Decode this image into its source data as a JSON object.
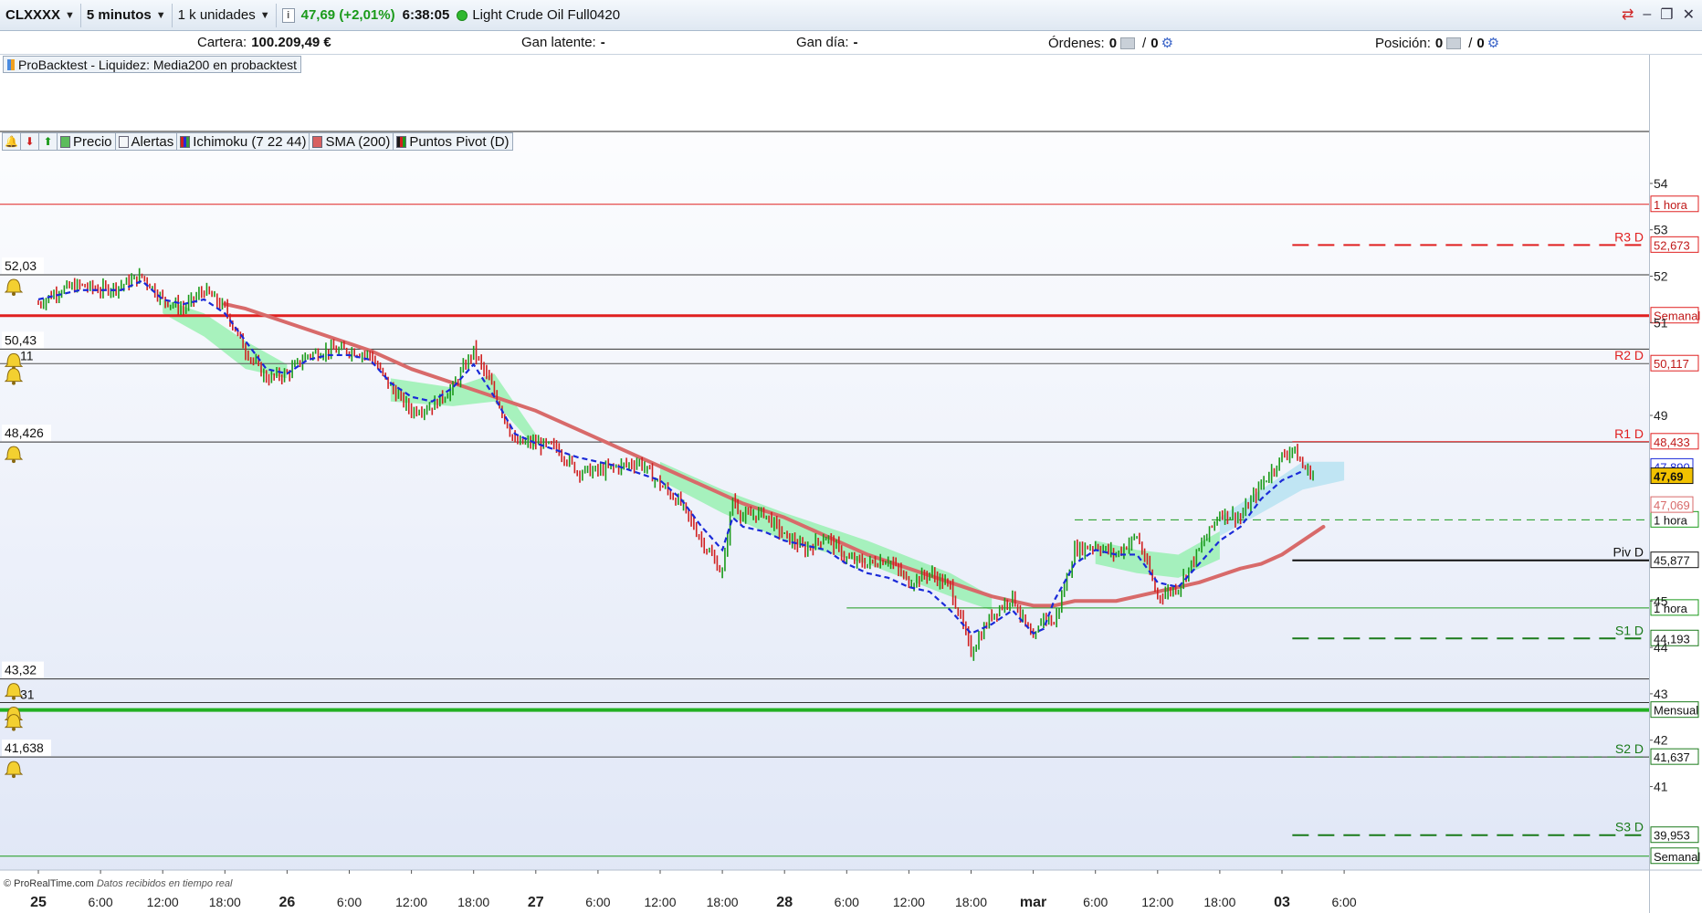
{
  "toolbar": {
    "symbol": "CLXXXX",
    "timeframe": "5 minutos",
    "units": "1 k unidades",
    "info_icon": "info-icon",
    "price": "47,69 (+2,01%)",
    "time": "6:38:05",
    "instrument": "Light Crude Oil Full0420"
  },
  "status": {
    "cartera_label": "Cartera:",
    "cartera_value": "100.209,49 €",
    "gan_latente_label": "Gan latente:",
    "gan_latente_value": "-",
    "gan_dia_label": "Gan día:",
    "gan_dia_value": "-",
    "ordenes_label": "Órdenes:",
    "ordenes_value": "0",
    "ordenes_value2": "0",
    "posicion_label": "Posición:",
    "posicion_value": "0",
    "posicion_value2": "0"
  },
  "probacktest_label": "ProBacktest - Liquidez: Media200 en probacktest",
  "indicators": [
    {
      "label": "Precio",
      "color": "#5cbc5c"
    },
    {
      "label": "Alertas",
      "color": "#f4f6f8"
    },
    {
      "label": "Ichimoku (7 22 44)",
      "color": "#5a3ad0"
    },
    {
      "label": "SMA (200)",
      "color": "#d86060"
    },
    {
      "label": "Puntos Pivot (D)",
      "color": "#1a7a1a"
    }
  ],
  "copyright": "© ProRealTime.com",
  "copyright_note": "Datos recibidos en tiempo real",
  "colors": {
    "sma": "#d86a6a",
    "ichimoku_kijun": "#1a2ad8",
    "cloud_green": "#8ef0a8",
    "cloud_blue": "#b0e0f0",
    "pivot_red": "#e02020",
    "pivot_green": "#1a7a1a",
    "price_tag": "#f2c200"
  },
  "chart_data": {
    "type": "line",
    "title": "",
    "ylim": [
      39.2,
      55.1
    ],
    "y_ticks": [
      41,
      42,
      43,
      44,
      45,
      49,
      51,
      52,
      53,
      54
    ],
    "x_ticks": [
      {
        "label": "25",
        "bold": true,
        "t": 0
      },
      {
        "label": "6:00",
        "t": 6
      },
      {
        "label": "12:00",
        "t": 12
      },
      {
        "label": "18:00",
        "t": 18
      },
      {
        "label": "26",
        "bold": true,
        "t": 24
      },
      {
        "label": "6:00",
        "t": 30
      },
      {
        "label": "12:00",
        "t": 36
      },
      {
        "label": "18:00",
        "t": 42
      },
      {
        "label": "27",
        "bold": true,
        "t": 48
      },
      {
        "label": "6:00",
        "t": 54
      },
      {
        "label": "12:00",
        "t": 60
      },
      {
        "label": "18:00",
        "t": 66
      },
      {
        "label": "28",
        "bold": true,
        "t": 72
      },
      {
        "label": "6:00",
        "t": 78
      },
      {
        "label": "12:00",
        "t": 84
      },
      {
        "label": "18:00",
        "t": 90
      },
      {
        "label": "mar",
        "bold": true,
        "t": 96
      },
      {
        "label": "6:00",
        "t": 102
      },
      {
        "label": "12:00",
        "t": 108
      },
      {
        "label": "18:00",
        "t": 114
      },
      {
        "label": "03",
        "bold": true,
        "t": 120
      },
      {
        "label": "6:00",
        "t": 126
      }
    ],
    "price_series": {
      "name": "Precio",
      "t": [
        0,
        2,
        4,
        6,
        8,
        10,
        12,
        14,
        16,
        18,
        20,
        22,
        24,
        26,
        28,
        30,
        32,
        34,
        36,
        38,
        40,
        42,
        44,
        46,
        48,
        50,
        52,
        54,
        56,
        58,
        60,
        62,
        64,
        66,
        67,
        68,
        70,
        72,
        74,
        76,
        78,
        80,
        82,
        84,
        86,
        88,
        90,
        92,
        94,
        96,
        97,
        98,
        100,
        102,
        104,
        106,
        108,
        110,
        112,
        114,
        116,
        118,
        120,
        121,
        122,
        123
      ],
      "y": [
        51.4,
        51.7,
        51.8,
        51.7,
        51.8,
        52.0,
        51.5,
        51.3,
        51.7,
        51.3,
        50.4,
        49.8,
        49.9,
        50.3,
        50.4,
        50.4,
        50.3,
        49.6,
        49.1,
        49.2,
        49.6,
        50.4,
        49.5,
        48.4,
        48.4,
        48.3,
        47.8,
        47.8,
        47.9,
        48.0,
        47.5,
        47.1,
        46.3,
        45.6,
        47.2,
        46.8,
        46.9,
        46.4,
        46.1,
        46.4,
        45.9,
        45.8,
        45.9,
        45.4,
        45.6,
        45.3,
        43.9,
        44.7,
        45.1,
        44.1,
        44.7,
        44.5,
        46.1,
        46.2,
        46.0,
        46.4,
        45.1,
        45.3,
        46.1,
        46.9,
        46.8,
        47.5,
        48.1,
        48.3,
        47.9,
        47.7
      ]
    },
    "kijun_series": {
      "name": "Ichimoku",
      "t": [
        0,
        4,
        8,
        10,
        12,
        14,
        16,
        18,
        20,
        22,
        24,
        26,
        28,
        30,
        32,
        34,
        36,
        38,
        40,
        42,
        44,
        46,
        48,
        52,
        56,
        60,
        62,
        64,
        66,
        67,
        68,
        70,
        72,
        74,
        76,
        78,
        80,
        82,
        84,
        86,
        88,
        90,
        92,
        94,
        96,
        97,
        98,
        100,
        102,
        104,
        106,
        108,
        110,
        112,
        114,
        116,
        118,
        120,
        122
      ],
      "y": [
        51.5,
        51.7,
        51.7,
        51.9,
        51.5,
        51.4,
        51.5,
        51.2,
        50.6,
        50.0,
        49.9,
        50.2,
        50.3,
        50.3,
        50.2,
        49.7,
        49.4,
        49.3,
        49.6,
        50.1,
        49.4,
        48.6,
        48.4,
        48.1,
        47.9,
        47.6,
        47.2,
        46.6,
        46.1,
        46.8,
        46.6,
        46.5,
        46.3,
        46.2,
        46.1,
        45.8,
        45.6,
        45.5,
        45.3,
        45.2,
        44.8,
        44.3,
        44.5,
        44.8,
        44.3,
        44.4,
        45.0,
        45.8,
        46.1,
        46.0,
        46.0,
        45.4,
        45.3,
        45.8,
        46.3,
        46.6,
        47.2,
        47.6,
        47.8
      ]
    },
    "sma_series": {
      "name": "SMA (200)",
      "t": [
        18,
        20,
        24,
        28,
        32,
        36,
        40,
        44,
        48,
        52,
        56,
        60,
        64,
        68,
        72,
        76,
        80,
        84,
        88,
        92,
        96,
        98,
        100,
        104,
        108,
        112,
        116,
        118,
        120,
        122,
        124
      ],
      "y": [
        51.4,
        51.3,
        51.0,
        50.7,
        50.4,
        50.0,
        49.7,
        49.4,
        49.1,
        48.7,
        48.3,
        47.9,
        47.5,
        47.1,
        46.8,
        46.4,
        46.0,
        45.7,
        45.4,
        45.1,
        44.9,
        44.9,
        45.0,
        45.0,
        45.2,
        45.4,
        45.7,
        45.8,
        46.0,
        46.3,
        46.6
      ]
    },
    "cloud_segments": [
      {
        "t": [
          12,
          16,
          20,
          24
        ],
        "top": [
          51.5,
          51.2,
          50.6,
          50.1
        ],
        "bottom": [
          51.2,
          50.7,
          50.0,
          49.8
        ],
        "color": "green"
      },
      {
        "t": [
          34,
          40,
          44,
          48
        ],
        "top": [
          49.8,
          49.6,
          49.9,
          48.6
        ],
        "bottom": [
          49.3,
          49.2,
          49.3,
          48.3
        ],
        "color": "green"
      },
      {
        "t": [
          60,
          66,
          72,
          80,
          88,
          92
        ],
        "top": [
          48.0,
          47.4,
          46.9,
          46.3,
          45.6,
          45.1
        ],
        "bottom": [
          47.6,
          46.9,
          46.3,
          45.8,
          45.1,
          44.8
        ],
        "color": "green"
      },
      {
        "t": [
          102,
          106,
          110,
          114
        ],
        "top": [
          46.3,
          46.1,
          46.0,
          46.5
        ],
        "bottom": [
          45.8,
          45.6,
          45.5,
          45.9
        ],
        "color": "green"
      },
      {
        "t": [
          114,
          118,
          122,
          126
        ],
        "top": [
          46.8,
          47.4,
          48.0,
          48.0
        ],
        "bottom": [
          46.4,
          46.9,
          47.4,
          47.6
        ],
        "color": "blue"
      }
    ],
    "horizontal_lines": [
      {
        "y": 53.55,
        "color": "#e02020",
        "width": 1,
        "style": "solid",
        "right_label": "1 hora",
        "right_color": "#e02020"
      },
      {
        "y": 52.673,
        "color": "#e02020",
        "width": 2,
        "style": "dashed",
        "start_t": 121,
        "name": "R3 D",
        "right_label": "52,673",
        "right_color": "#e02020"
      },
      {
        "y": 52.03,
        "color": "#333333",
        "width": 1,
        "style": "solid",
        "left_label": "52,03"
      },
      {
        "y": 51.15,
        "color": "#e02020",
        "width": 3,
        "style": "solid",
        "right_label": "Semanal",
        "right_color": "#e02020"
      },
      {
        "y": 50.43,
        "color": "#333333",
        "width": 1,
        "style": "solid",
        "left_label": "50,43"
      },
      {
        "y": 50.117,
        "color": "#555555",
        "width": 1,
        "style": "solid",
        "name": "R2 D",
        "right_label": "50,117",
        "right_color": "#e02020"
      },
      {
        "y": 48.426,
        "color": "#333333",
        "width": 1,
        "style": "solid",
        "left_label": "48,426"
      },
      {
        "y": 48.433,
        "color": "#e02020",
        "width": 1,
        "style": "solid",
        "start_t": 121,
        "name": "R1 D",
        "right_label": "48,433",
        "right_color": "#e02020"
      },
      {
        "y": 46.75,
        "color": "#1a9a1a",
        "width": 1,
        "style": "dashed",
        "start_t": 100,
        "right_label": "1 hora",
        "right_color": "#1a9a1a"
      },
      {
        "y": 45.877,
        "color": "#111111",
        "width": 2,
        "style": "solid",
        "start_t": 121,
        "name": "Piv D",
        "right_label": "45,877",
        "right_color": "#111111"
      },
      {
        "y": 44.85,
        "color": "#1a9a1a",
        "width": 1,
        "style": "solid",
        "start_t": 78,
        "right_label": "1 hora",
        "right_color": "#1a9a1a"
      },
      {
        "y": 44.193,
        "color": "#1a7a1a",
        "width": 2,
        "style": "dashed",
        "start_t": 121,
        "name": "S1 D",
        "right_label": "44,193",
        "right_color": "#1a7a1a"
      },
      {
        "y": 43.32,
        "color": "#333333",
        "width": 1,
        "style": "solid",
        "left_label": "43,32"
      },
      {
        "y": 42.81,
        "color": "#333333",
        "width": 1,
        "style": "solid"
      },
      {
        "y": 42.65,
        "color": "#22b022",
        "width": 4,
        "style": "solid",
        "right_label": "Mensual",
        "right_color": "#1a7a1a"
      },
      {
        "y": 41.638,
        "color": "#333333",
        "width": 1,
        "style": "solid",
        "left_label": "41,638"
      },
      {
        "y": 41.637,
        "color": "#1a7a1a",
        "width": 1,
        "style": "dashed",
        "start_t": 121,
        "name": "S2 D",
        "right_label": "41,637",
        "right_color": "#1a7a1a"
      },
      {
        "y": 39.953,
        "color": "#1a7a1a",
        "width": 2,
        "style": "dashed",
        "start_t": 121,
        "name": "S3 D",
        "right_label": "39,953",
        "right_color": "#1a7a1a"
      },
      {
        "y": 39.5,
        "color": "#1a9a1a",
        "width": 1,
        "style": "solid",
        "right_label": "Semanal",
        "right_color": "#1a7a1a"
      }
    ],
    "price_tags": [
      {
        "y": 47.89,
        "label": "47,890",
        "color": "#1a2ad8",
        "bg": "#ffffff"
      },
      {
        "y": 47.69,
        "label": "47,69",
        "color": "#111111",
        "bg": "#f2c200"
      },
      {
        "y": 47.069,
        "label": "47,069",
        "color": "#d86a6a",
        "bg": "#ffffff"
      }
    ],
    "alert_bells": [
      52.03,
      50.43,
      50.11,
      48.426,
      43.32,
      42.81,
      42.65,
      41.638
    ],
    "extra_left_labels": [
      {
        "y": 50.11,
        "label": "11"
      },
      {
        "y": 42.81,
        "label": "31"
      }
    ]
  }
}
